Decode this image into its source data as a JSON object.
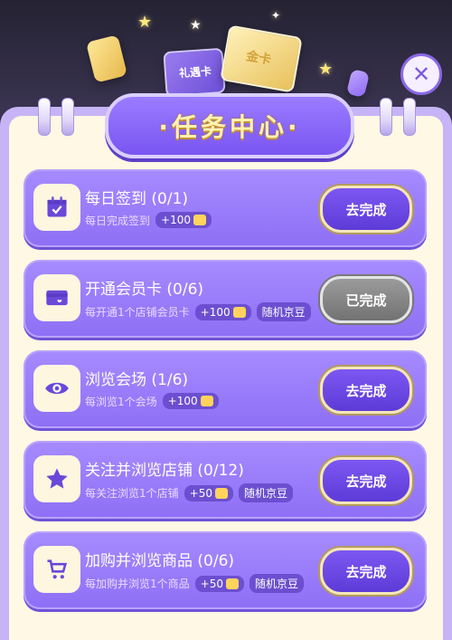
{
  "header": {
    "title": "·任务中心·",
    "decor_card1_text": "礼遇卡",
    "decor_card2_text": "金卡",
    "close_symbol": "✕"
  },
  "tasks": [
    {
      "title": "每日签到 (0/1)",
      "desc": "每日完成签到",
      "reward": "+100",
      "extra": "",
      "button": "去完成",
      "status": "todo",
      "icon": "calendar-check-icon"
    },
    {
      "title": "开通会员卡 (0/6)",
      "desc": "每开通1个店铺会员卡",
      "reward": "+100",
      "extra": "随机京豆",
      "button": "已完成",
      "status": "done",
      "icon": "membership-card-icon"
    },
    {
      "title": "浏览会场 (1/6)",
      "desc": "每浏览1个会场",
      "reward": "+100",
      "extra": "",
      "button": "去完成",
      "status": "todo",
      "icon": "eye-icon"
    },
    {
      "title": "关注并浏览店铺 (0/12)",
      "desc": "每关注浏览1个店铺",
      "reward": "+50",
      "extra": "随机京豆",
      "button": "去完成",
      "status": "todo",
      "icon": "star-icon"
    },
    {
      "title": "加购并浏览商品 (0/6)",
      "desc": "每加购并浏览1个商品",
      "reward": "+50",
      "extra": "随机京豆",
      "button": "去完成",
      "status": "todo",
      "icon": "cart-icon"
    }
  ],
  "colors": {
    "accent": "#7a55f2",
    "done_gray": "#8a8a8a",
    "panel_bg": "#fff8e4",
    "title_gold": "#fff3b0"
  }
}
